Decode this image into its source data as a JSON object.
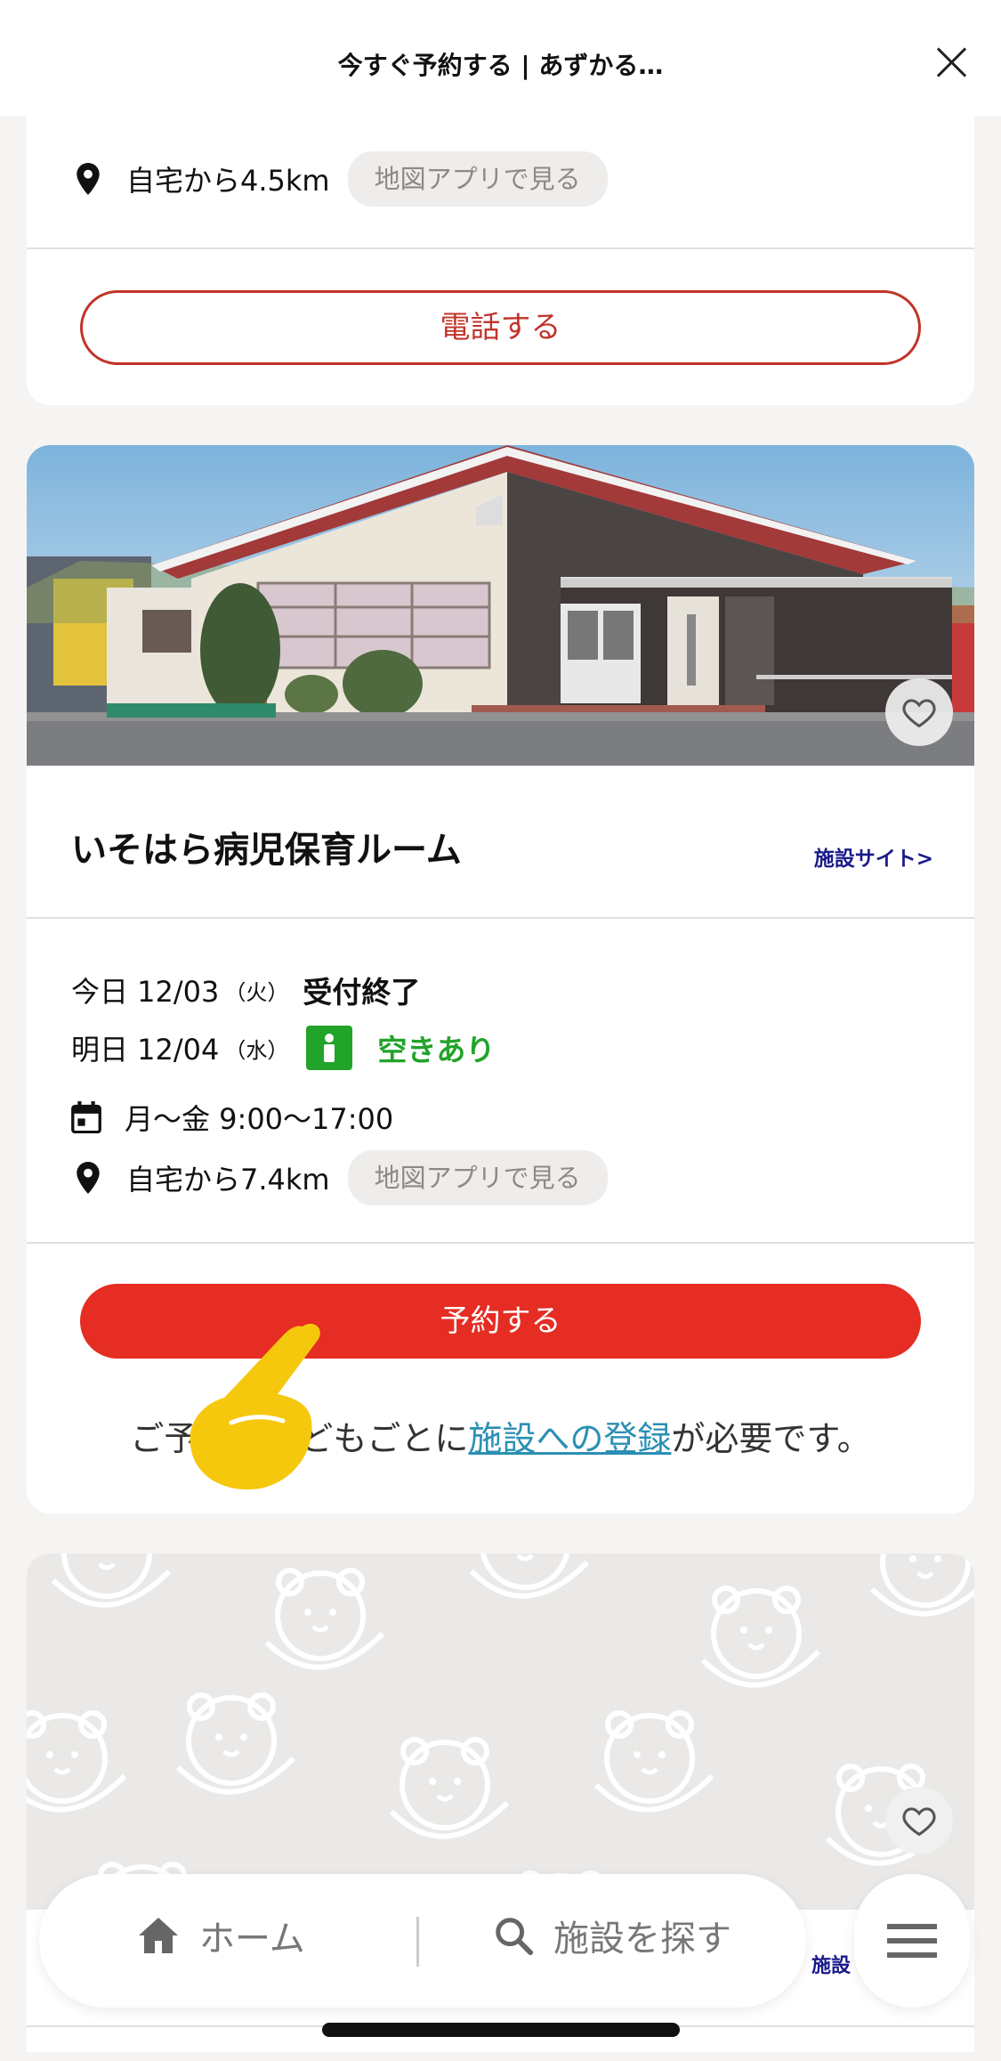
{
  "header": {
    "title": "今すぐ予約する | あずかる…"
  },
  "card1": {
    "distance": "自宅から4.5km",
    "map_chip": "地図アプリで見る",
    "call_label": "電話する"
  },
  "card2": {
    "name": "いそはら病児保育ルーム",
    "site_link": "施設サイト>",
    "today_label": "今日 12/03",
    "today_dow": "（火）",
    "today_status": "受付終了",
    "tomorrow_label": "明日 12/04",
    "tomorrow_dow": "（水）",
    "tomorrow_status": "空きあり",
    "hours": "月〜金 9:00〜17:00",
    "distance": "自宅から7.4km",
    "map_chip": "地図アプリで見る",
    "reserve_label": "予約する",
    "note_prefix": "ご予約の",
    "note_middle": "子どもごとに",
    "note_link": "施設への登録",
    "note_suffix": "が必要です。"
  },
  "bottom_nav": {
    "home_label": "ホーム",
    "search_label": "施設を探す",
    "peek_link": "施設"
  },
  "colors": {
    "accent_red": "#e52d23",
    "outline_red": "#c1342a",
    "available_green": "#22a32a",
    "link_blue": "#2b8fb3",
    "site_link_navy": "#1a1a8c"
  },
  "icons": [
    "location-pin-icon",
    "calendar-icon",
    "heart-icon",
    "home-icon",
    "search-icon",
    "hamburger-menu-icon",
    "pointing-hand-icon",
    "close-icon"
  ]
}
